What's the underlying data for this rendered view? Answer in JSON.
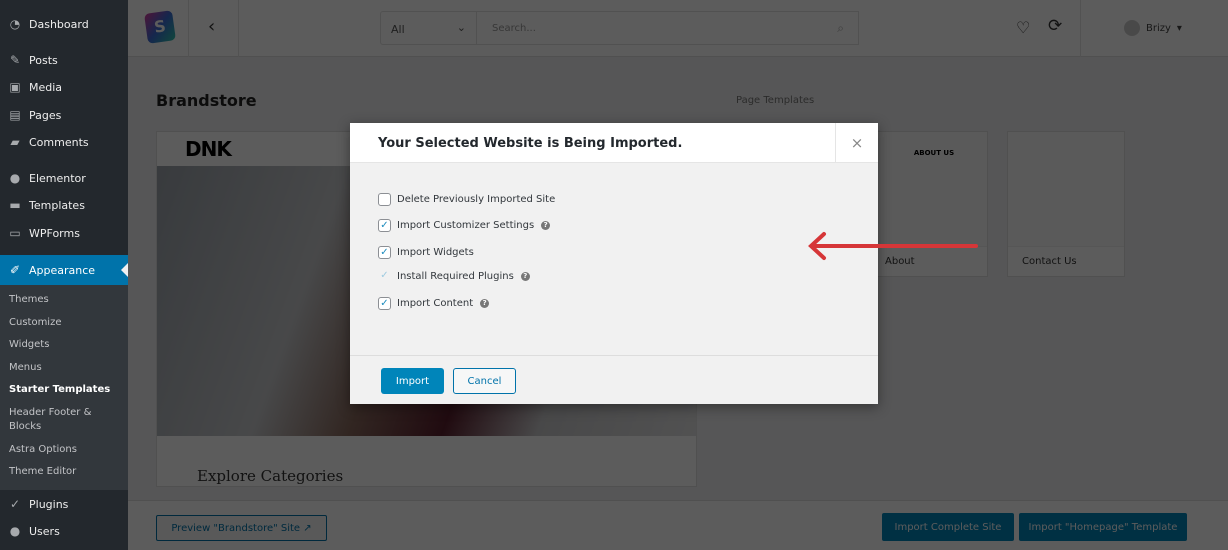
{
  "sidebar": {
    "items": [
      {
        "label": "Dashboard",
        "icon": "dashboard-icon"
      },
      {
        "label": "Posts",
        "icon": "pin-icon"
      },
      {
        "label": "Media",
        "icon": "media-icon"
      },
      {
        "label": "Pages",
        "icon": "pages-icon"
      },
      {
        "label": "Comments",
        "icon": "comment-icon"
      },
      {
        "label": "Elementor",
        "icon": "elementor-icon"
      },
      {
        "label": "Templates",
        "icon": "folder-icon"
      },
      {
        "label": "WPForms",
        "icon": "forms-icon"
      },
      {
        "label": "Appearance",
        "icon": "brush-icon"
      },
      {
        "label": "Plugins",
        "icon": "plugin-icon"
      },
      {
        "label": "Users",
        "icon": "user-icon"
      }
    ],
    "submenu": [
      "Themes",
      "Customize",
      "Widgets",
      "Menus",
      "Starter Templates",
      "Header Footer &",
      "Blocks",
      "Astra Options",
      "Theme Editor"
    ]
  },
  "topbar": {
    "filter": "All",
    "search_placeholder": "Search...",
    "user": "Brizy"
  },
  "main": {
    "title": "Brandstore",
    "page_templates_label": "Page Templates",
    "preview_logo": "DNK",
    "preview_heading": "Explore Categories",
    "templates": [
      {
        "label": "About",
        "thumb_title": "ABOUT US"
      },
      {
        "label": "Contact Us"
      }
    ]
  },
  "bottom": {
    "preview": "Preview \"Brandstore\" Site",
    "import_site": "Import Complete Site",
    "import_homepage": "Import \"Homepage\" Template"
  },
  "modal": {
    "title": "Your Selected Website is Being Imported.",
    "close": "×",
    "options": [
      {
        "label": "Delete Previously Imported Site",
        "checked": false,
        "help": false
      },
      {
        "label": "Import Customizer Settings",
        "checked": true,
        "help": true
      },
      {
        "label": "Import Widgets",
        "checked": true,
        "help": true
      },
      {
        "label": "Install Required Plugins",
        "checked": true,
        "help": true
      },
      {
        "label": "Import Content",
        "checked": true,
        "help": true
      }
    ],
    "import": "Import",
    "cancel": "Cancel"
  },
  "colors": {
    "accent": "#0085ba",
    "arrow": "#d63638",
    "sidebar": "#23282d"
  }
}
